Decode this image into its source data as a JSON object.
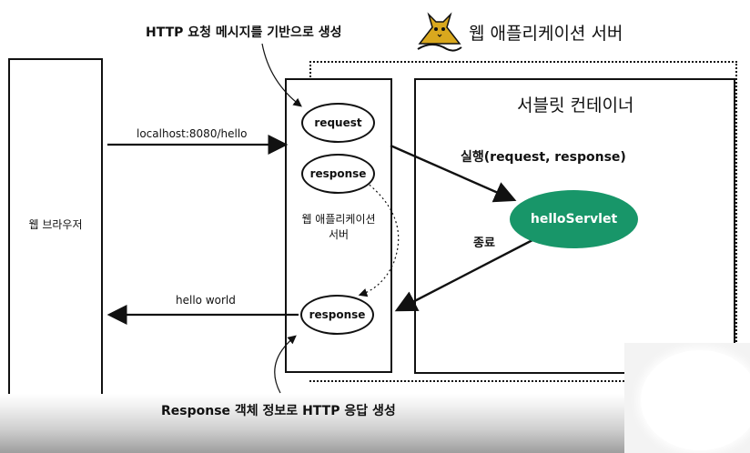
{
  "labels": {
    "top_request_note": "HTTP 요청 메시지를 기반으로 생성",
    "was_title": "웹 애플리케이션 서버",
    "servlet_container": "서블릿 컨테이너",
    "browser": "웹 브라우저",
    "url": "localhost:8080/hello",
    "request": "request",
    "response_top": "response",
    "response_bottom": "response",
    "was_inner_line1": "웹 애플리케이션",
    "was_inner_line2": "서버",
    "execute": "실행(request, response)",
    "servlet": "helloServlet",
    "finish": "종료",
    "hello_world": "hello world",
    "bottom_note": "Response 객체 정보로 HTTP 응답 생성"
  },
  "icons": {
    "was_logo": "tomcat-cat-icon"
  },
  "colors": {
    "servlet_fill": "#189669",
    "line": "#111111",
    "logo": "#d9a81e"
  }
}
